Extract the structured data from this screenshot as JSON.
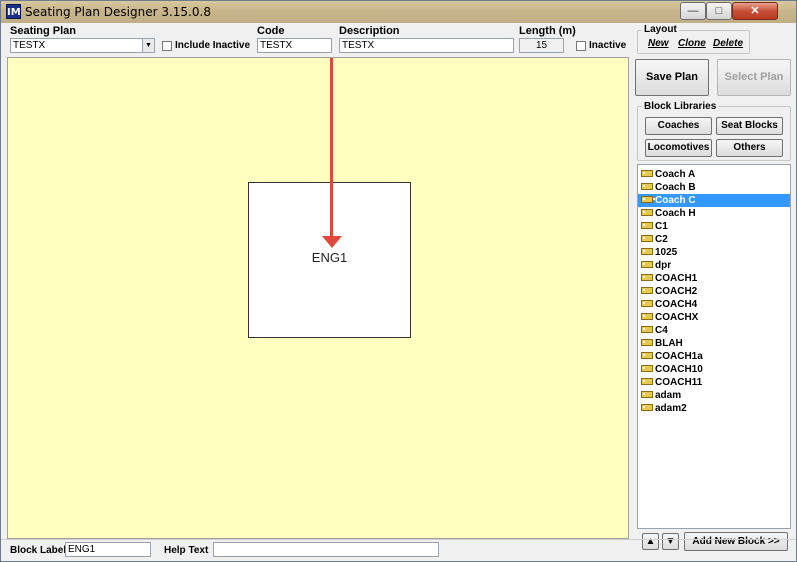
{
  "window": {
    "title": "Seating Plan Designer  3.15.0.8",
    "icon_text": "IM",
    "min_glyph": "—",
    "max_glyph": "□",
    "close_glyph": "✕"
  },
  "header": {
    "seating_plan_label": "Seating Plan",
    "seating_plan_value": "TESTX",
    "include_inactive_label": "Include Inactive",
    "code_label": "Code",
    "code_value": "TESTX",
    "description_label": "Description",
    "description_value": "TESTX",
    "length_label": "Length (m)",
    "length_value": "15",
    "inactive_label": "Inactive"
  },
  "layout": {
    "title": "Layout",
    "new_label": "New",
    "clone_label": "Clone",
    "delete_label": "Delete"
  },
  "actions": {
    "save_plan_label": "Save Plan",
    "select_plan_label": "Select Plan"
  },
  "block_libraries": {
    "title": "Block Libraries",
    "coaches_label": "Coaches",
    "seat_blocks_label": "Seat Blocks",
    "locomotives_label": "Locomotives",
    "others_label": "Others"
  },
  "canvas": {
    "block_label": "ENG1",
    "background_color": "#ffffc0"
  },
  "block_list": {
    "items": [
      "Coach A",
      "Coach B",
      "Coach C",
      "Coach H",
      "C1",
      "C2",
      "1025",
      "dpr",
      "COACH1",
      "COACH2",
      "COACH4",
      "COACHX",
      "C4",
      "BLAH",
      "COACH1a",
      "COACH10",
      "COACH11",
      "adam",
      "adam2"
    ],
    "selected": "Coach C",
    "move_up_glyph": "▲",
    "move_down_glyph": "▼",
    "add_new_block_label": "Add New Block >>"
  },
  "footer": {
    "block_label_caption": "Block Label",
    "block_label_value": "ENG1",
    "help_text_caption": "Help Text",
    "help_text_value": ""
  },
  "colors": {
    "selection": "#3399ff",
    "annotation_arrow": "#e04a3a"
  }
}
